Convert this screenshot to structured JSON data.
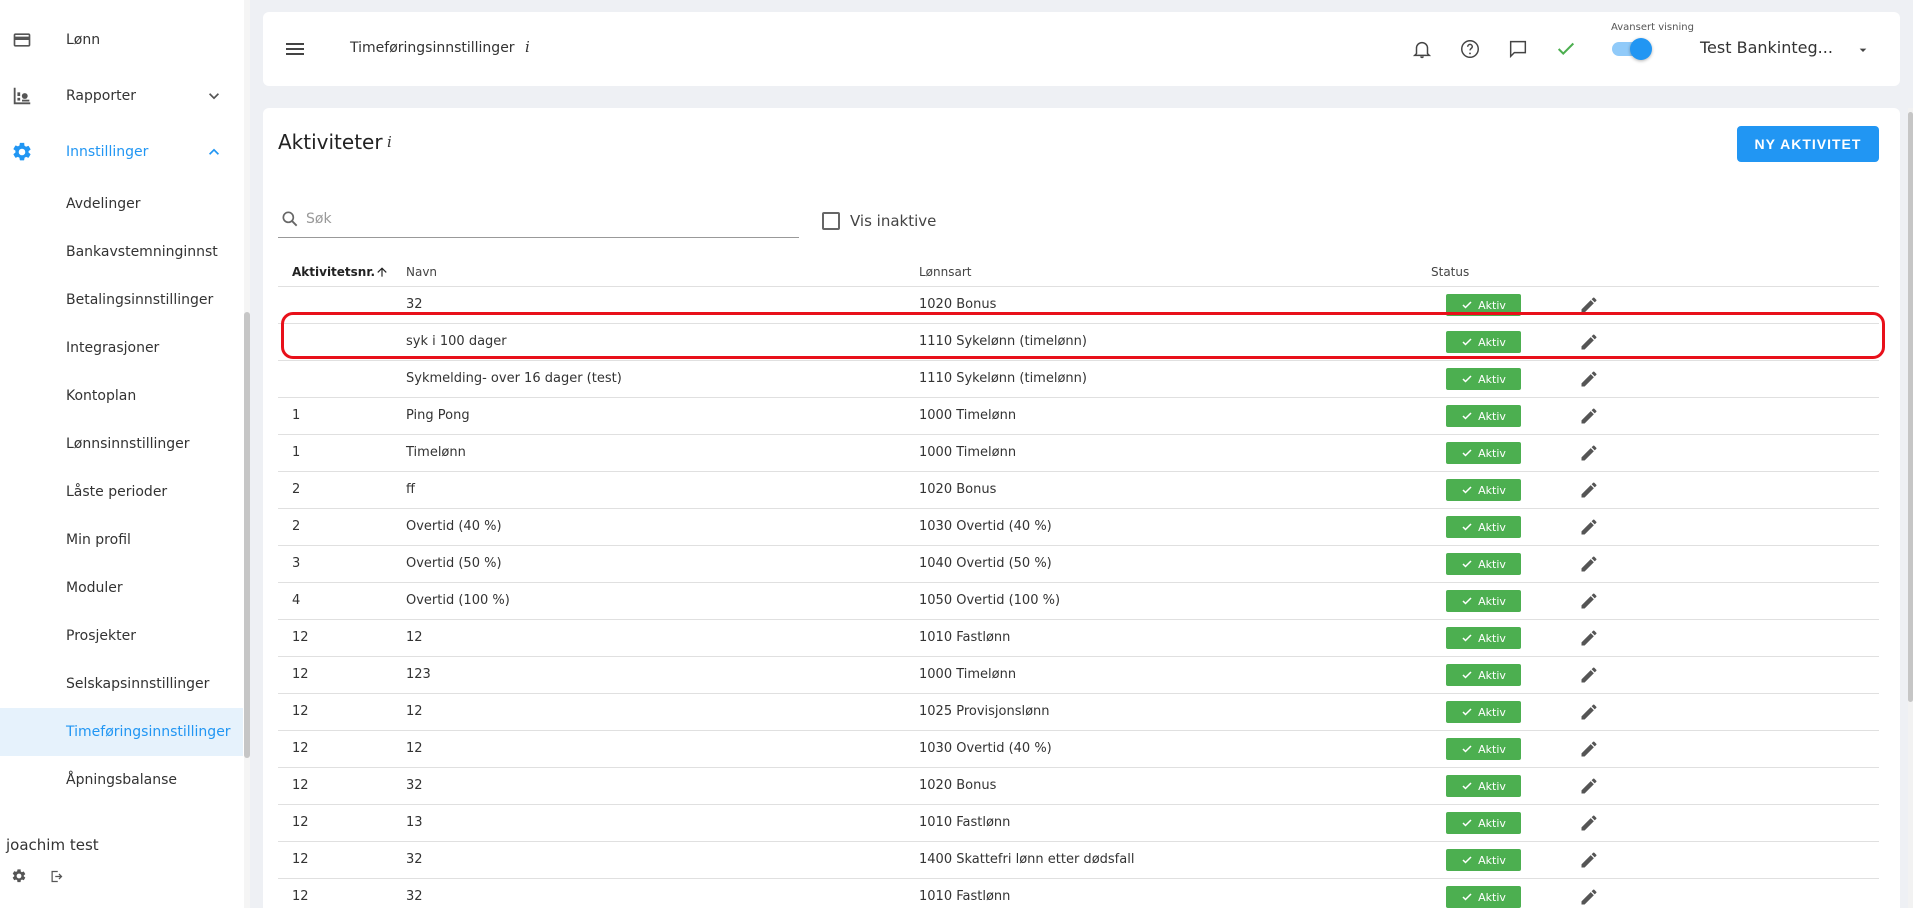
{
  "sidebar": {
    "top_items": [
      {
        "label": "Lønn",
        "icon": "credit-card-icon"
      },
      {
        "label": "Rapporter",
        "icon": "report-chart-icon"
      },
      {
        "label": "Innstillinger",
        "icon": "gear-icon"
      }
    ],
    "sub_items": [
      {
        "label": "Avdelinger"
      },
      {
        "label": "Bankavstemninginnst"
      },
      {
        "label": "Betalingsinnstillinger"
      },
      {
        "label": "Integrasjoner"
      },
      {
        "label": "Kontoplan"
      },
      {
        "label": "Lønnsinnstillinger"
      },
      {
        "label": "Låste perioder"
      },
      {
        "label": "Min profil"
      },
      {
        "label": "Moduler"
      },
      {
        "label": "Prosjekter"
      },
      {
        "label": "Selskapsinnstillinger"
      },
      {
        "label": "Timeføringsinnstillinger"
      },
      {
        "label": "Åpningsbalanse"
      }
    ],
    "active_sub_item": "Timeføringsinnstillinger",
    "user_name": "joachim test"
  },
  "header": {
    "title": "Timeføringsinnstillinger",
    "info": "i",
    "advanced_view_label": "Avansert visning",
    "advanced_view_on": true,
    "company": "Test Bankinteg..."
  },
  "main": {
    "title": "Aktiviteter",
    "info": "i",
    "new_button": "NY AKTIVITET",
    "search_placeholder": "Søk",
    "show_inactive_label": "Vis inaktive",
    "show_inactive_checked": false,
    "columns": {
      "number": "Aktivitetsnr.",
      "name": "Navn",
      "wage_type": "Lønnsart",
      "status": "Status"
    },
    "rows": [
      {
        "number": "",
        "name": "32",
        "wage_type": "1020 Bonus",
        "status": "Aktiv"
      },
      {
        "number": "",
        "name": "syk i 100 dager",
        "wage_type": "1110 Sykelønn (timelønn)",
        "status": "Aktiv"
      },
      {
        "number": "",
        "name": "Sykmelding- over 16 dager (test)",
        "wage_type": "1110 Sykelønn (timelønn)",
        "status": "Aktiv"
      },
      {
        "number": "1",
        "name": "Ping Pong",
        "wage_type": "1000 Timelønn",
        "status": "Aktiv"
      },
      {
        "number": "1",
        "name": "Timelønn",
        "wage_type": "1000 Timelønn",
        "status": "Aktiv"
      },
      {
        "number": "2",
        "name": "ff",
        "wage_type": "1020 Bonus",
        "status": "Aktiv"
      },
      {
        "number": "2",
        "name": "Overtid (40 %)",
        "wage_type": "1030 Overtid (40 %)",
        "status": "Aktiv"
      },
      {
        "number": "3",
        "name": "Overtid (50 %)",
        "wage_type": "1040 Overtid (50 %)",
        "status": "Aktiv"
      },
      {
        "number": "4",
        "name": "Overtid (100 %)",
        "wage_type": "1050 Overtid (100 %)",
        "status": "Aktiv"
      },
      {
        "number": "12",
        "name": "12",
        "wage_type": "1010 Fastlønn",
        "status": "Aktiv"
      },
      {
        "number": "12",
        "name": "123",
        "wage_type": "1000 Timelønn",
        "status": "Aktiv"
      },
      {
        "number": "12",
        "name": "12",
        "wage_type": "1025 Provisjonslønn",
        "status": "Aktiv"
      },
      {
        "number": "12",
        "name": "12",
        "wage_type": "1030 Overtid (40 %)",
        "status": "Aktiv"
      },
      {
        "number": "12",
        "name": "32",
        "wage_type": "1020 Bonus",
        "status": "Aktiv"
      },
      {
        "number": "12",
        "name": "13",
        "wage_type": "1010 Fastlønn",
        "status": "Aktiv"
      },
      {
        "number": "12",
        "name": "32",
        "wage_type": "1400 Skattefri lønn etter dødsfall",
        "status": "Aktiv"
      },
      {
        "number": "12",
        "name": "32",
        "wage_type": "1010 Fastlønn",
        "status": "Aktiv"
      }
    ],
    "highlighted_row": "syk i 100 dager"
  },
  "colors": {
    "accent": "#2196f3",
    "status_active": "#4caf50",
    "highlight": "#e8101a",
    "check": "#4caf50"
  }
}
